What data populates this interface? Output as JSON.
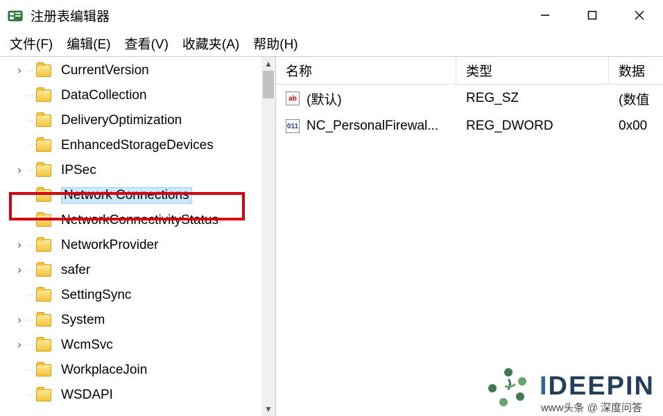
{
  "window": {
    "title": "注册表编辑器"
  },
  "menu": {
    "file": "文件(F)",
    "edit": "编辑(E)",
    "view": "查看(V)",
    "favorites": "收藏夹(A)",
    "help": "帮助(H)"
  },
  "tree": {
    "items": [
      {
        "label": "CurrentVersion",
        "expandable": true
      },
      {
        "label": "DataCollection",
        "expandable": false
      },
      {
        "label": "DeliveryOptimization",
        "expandable": false
      },
      {
        "label": "EnhancedStorageDevices",
        "expandable": false
      },
      {
        "label": "IPSec",
        "expandable": true
      },
      {
        "label": "Network Connections",
        "expandable": false,
        "selected": true,
        "highlighted": true
      },
      {
        "label": "NetworkConnectivityStatus",
        "expandable": false
      },
      {
        "label": "NetworkProvider",
        "expandable": true
      },
      {
        "label": "safer",
        "expandable": true
      },
      {
        "label": "SettingSync",
        "expandable": false
      },
      {
        "label": "System",
        "expandable": true
      },
      {
        "label": "WcmSvc",
        "expandable": true
      },
      {
        "label": "WorkplaceJoin",
        "expandable": false
      },
      {
        "label": "WSDAPI",
        "expandable": false
      }
    ]
  },
  "list": {
    "header": {
      "name": "名称",
      "type": "类型",
      "data": "数据"
    },
    "rows": [
      {
        "icon": "sz",
        "icon_text": "ab",
        "name": "(默认)",
        "type": "REG_SZ",
        "data": "(数值"
      },
      {
        "icon": "dw",
        "icon_text": "011",
        "name": "NC_PersonalFirewal...",
        "type": "REG_DWORD",
        "data": "0x00"
      }
    ]
  },
  "watermark": {
    "brand": "IDEEPIN",
    "attribution": "www头条 @ 深度问答"
  }
}
